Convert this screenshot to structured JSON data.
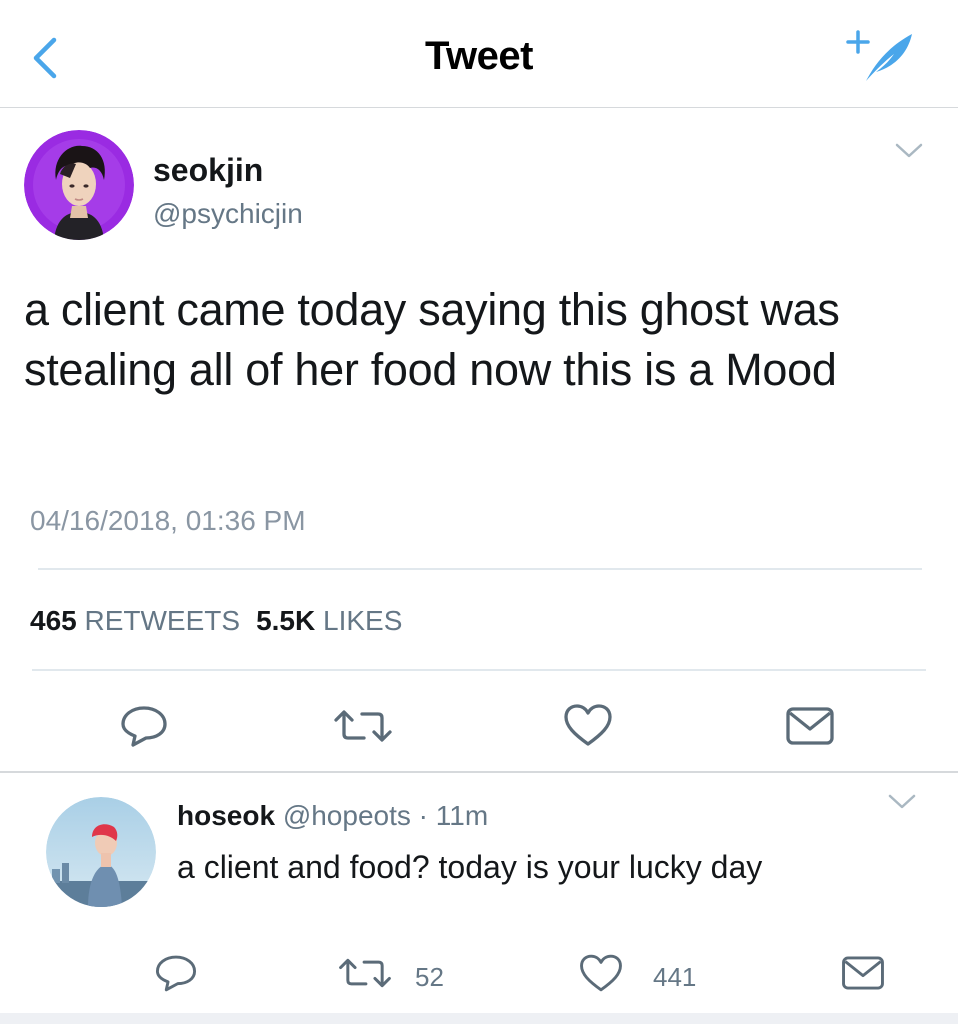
{
  "header": {
    "title": "Tweet",
    "back_icon": "chevron-left-icon",
    "compose_icon": "compose-tweet-icon",
    "accent_color": "#4aa6ea"
  },
  "tweet": {
    "author_name": "seokjin",
    "author_handle": "@psychicjin",
    "text": "a client came today saying this ghost was stealing all of her food now this is a Mood",
    "timestamp": "04/16/2018, 01:36 PM",
    "retweets_count": "465",
    "retweets_label": "RETWEETS",
    "likes_count": "5.5K",
    "likes_label": "LIKES",
    "actions": [
      "reply-icon",
      "retweet-icon",
      "like-icon",
      "direct-message-icon"
    ]
  },
  "reply": {
    "author_name": "hoseok",
    "author_handle": "@hopeots",
    "separator": "·",
    "time_ago": "11m",
    "text": "a client and food? today is your lucky day",
    "retweets_count": "52",
    "likes_count": "441",
    "actions": [
      "reply-icon",
      "retweet-icon",
      "like-icon",
      "direct-message-icon"
    ]
  }
}
